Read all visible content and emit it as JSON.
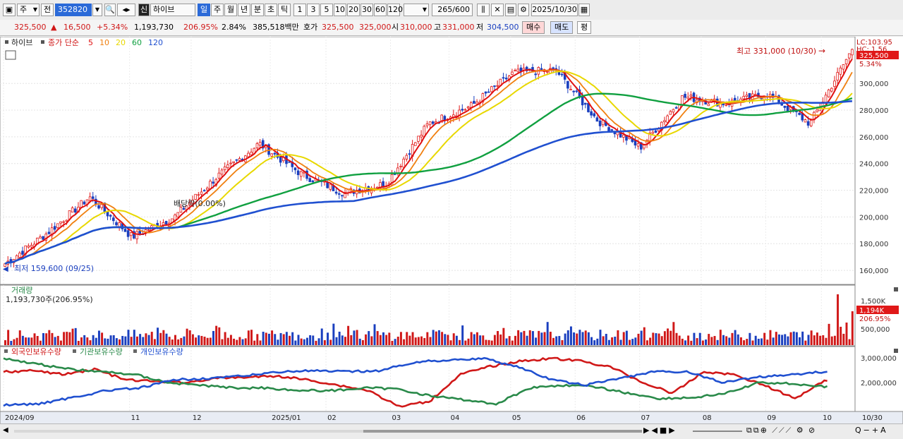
{
  "toolbar": {
    "period_main": "주",
    "jeon_label": "전",
    "stock_code": "352820",
    "sin_label": "신",
    "stock_name": "하이브",
    "period_tabs": [
      "일",
      "주",
      "월",
      "년",
      "분",
      "초",
      "틱"
    ],
    "minute_tabs": [
      "1",
      "3",
      "5",
      "10",
      "20",
      "30",
      "60",
      "120"
    ],
    "count_display": "265",
    "count_total": "/600",
    "date": "2025/10/30"
  },
  "quote": {
    "price": "325,500",
    "change": "16,500",
    "change_pct": "+5.34%",
    "volume": "1,193,730",
    "volume_ratio": "206.95%",
    "turnover": "2.84%",
    "amount": "385,518백만",
    "ask_label": "호가",
    "ask": "325,500",
    "bid": "325,000",
    "open_label": "시",
    "open": "310,000",
    "high_label": "고",
    "high": "331,000",
    "low_label": "저",
    "low": "304,500",
    "buy_label": "매수",
    "sell_label": "매도",
    "extra_label": "평"
  },
  "legend": {
    "stock": "하이브",
    "ma_title": "종가 단순",
    "ma_periods": [
      {
        "label": "5",
        "color": "#e01010"
      },
      {
        "label": "10",
        "color": "#f08010"
      },
      {
        "label": "20",
        "color": "#e8d800"
      },
      {
        "label": "60",
        "color": "#10a040"
      },
      {
        "label": "120",
        "color": "#2050d0"
      }
    ]
  },
  "annotations": {
    "high": "최고 331,000 (10/30)",
    "low": "최저 159,600 (09/25)",
    "dividend": "배당락(0.00%)",
    "lc": "LC:103.95",
    "hc": "HC: 1.56",
    "price_tag": "325,500",
    "pct_tag": "5.34%"
  },
  "price_axis": [
    "300,000",
    "280,000",
    "260,000",
    "240,000",
    "220,000",
    "200,000",
    "180,000",
    "160,000"
  ],
  "volume_panel": {
    "title": "거래량",
    "value": "1,193,730주(206.95%)",
    "axis": [
      "1,500K",
      "500,000"
    ],
    "tag": "1,194K",
    "tag2": "206.95%"
  },
  "holdings_panel": {
    "series": [
      {
        "label": "외국인보유수량",
        "color": "#d01818"
      },
      {
        "label": "기관보유수량",
        "color": "#2a8a4a"
      },
      {
        "label": "개인보유수량",
        "color": "#2050d0"
      }
    ],
    "axis": [
      "3,000,000",
      "2,000,000"
    ]
  },
  "x_axis": [
    "2024/09",
    "11",
    "12",
    "2025/01",
    "02",
    "03",
    "04",
    "05",
    "06",
    "07",
    "08",
    "09",
    "10",
    "10/30"
  ],
  "colors": {
    "up": "#d01818",
    "down": "#1a3fbf",
    "selected": "#2b6ad8"
  },
  "chart_data": {
    "type": "candlestick",
    "symbol": "352820",
    "title": "하이브",
    "x": [
      "2024/09",
      "11",
      "12",
      "2025/01",
      "02",
      "03",
      "04",
      "05",
      "06",
      "07",
      "08",
      "09",
      "10",
      "10/30"
    ],
    "ylim": [
      150000,
      335000
    ],
    "close_trend": [
      {
        "date": "2024/09",
        "value": 165000
      },
      {
        "date": "11",
        "value": 188000
      },
      {
        "date": "11",
        "value": 215000
      },
      {
        "date": "12",
        "value": 185000
      },
      {
        "date": "2025/01",
        "value": 200000
      },
      {
        "date": "02",
        "value": 230000
      },
      {
        "date": "03",
        "value": 255000
      },
      {
        "date": "03",
        "value": 232000
      },
      {
        "date": "04",
        "value": 218000
      },
      {
        "date": "05",
        "value": 225000
      },
      {
        "date": "05",
        "value": 270000
      },
      {
        "date": "06",
        "value": 283000
      },
      {
        "date": "06",
        "value": 308000
      },
      {
        "date": "07",
        "value": 310000
      },
      {
        "date": "07",
        "value": 272000
      },
      {
        "date": "08",
        "value": 252000
      },
      {
        "date": "08",
        "value": 290000
      },
      {
        "date": "09",
        "value": 285000
      },
      {
        "date": "09",
        "value": 292000
      },
      {
        "date": "10",
        "value": 270000
      },
      {
        "date": "10/30",
        "value": 325500
      }
    ],
    "high": 331000,
    "low": 159600
  }
}
